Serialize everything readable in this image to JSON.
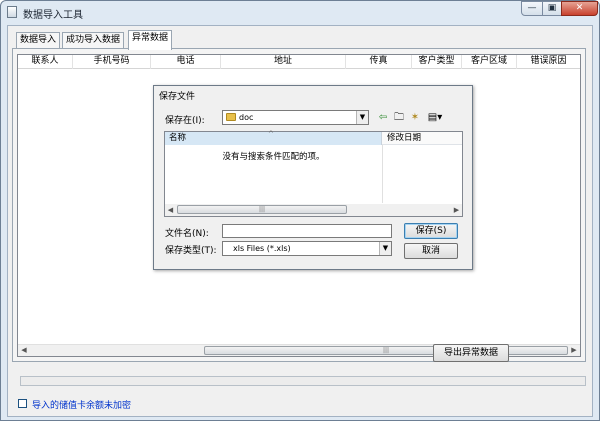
{
  "window": {
    "title": "数据导入工具",
    "controls": {
      "minimize": "—",
      "maximize": "▣",
      "close": "✕"
    }
  },
  "tabs": [
    {
      "label": "数据导入",
      "active": false
    },
    {
      "label": "成功导入数据",
      "active": false
    },
    {
      "label": "异常数据",
      "active": true
    }
  ],
  "grid": {
    "columns": [
      "联系人",
      "手机号码",
      "电话",
      "地址",
      "传真",
      "客户类型",
      "客户区域",
      "错误原因"
    ],
    "rows": []
  },
  "export_button": "导出异常数据",
  "checkbox": {
    "label": "导入的储值卡余额未加密",
    "checked": false
  },
  "save_dialog": {
    "title": "保存文件",
    "save_in_label": "保存在(I):",
    "save_in_value": "doc",
    "columns": {
      "name": "名称",
      "modified": "修改日期"
    },
    "empty_message": "没有与搜索条件匹配的项。",
    "filename_label": "文件名(N):",
    "filename_value": "",
    "filetype_label": "保存类型(T):",
    "filetype_value": "xls Files (*.xls)",
    "save_button": "保存(S)",
    "cancel_button": "取消",
    "toolbar_icons": [
      "back-arrow-icon",
      "up-folder-icon",
      "new-folder-icon",
      "view-menu-icon"
    ]
  },
  "colors": {
    "window_frame": "#dfe9f3",
    "close_button": "#c8412d",
    "selected_header": "#d6e7f5",
    "link_blue": "#0033cc"
  }
}
